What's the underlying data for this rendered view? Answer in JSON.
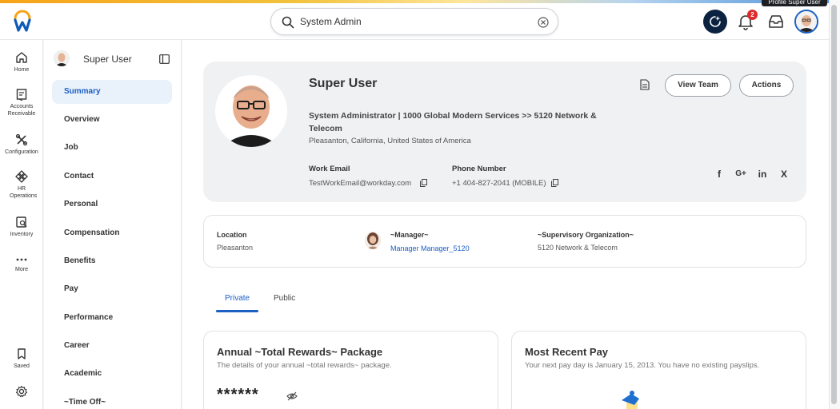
{
  "topbar": {
    "search_value": "System Admin",
    "notification_count": "2",
    "tooltip": "Profile Super User"
  },
  "rail": {
    "items": [
      {
        "label": "Home",
        "icon": "home-icon"
      },
      {
        "label": "Accounts Receivable",
        "icon": "invoice-icon"
      },
      {
        "label": "Configuration",
        "icon": "tools-icon"
      },
      {
        "label": "HR Operations",
        "icon": "hr-operations-icon"
      },
      {
        "label": "Inventory",
        "icon": "inventory-icon"
      },
      {
        "label": "More",
        "icon": "more-dots-icon"
      },
      {
        "label": "Saved",
        "icon": "bookmark-icon"
      }
    ]
  },
  "sidenav": {
    "user_name": "Super User",
    "items": [
      {
        "label": "Summary"
      },
      {
        "label": "Overview"
      },
      {
        "label": "Job"
      },
      {
        "label": "Contact"
      },
      {
        "label": "Personal"
      },
      {
        "label": "Compensation"
      },
      {
        "label": "Benefits"
      },
      {
        "label": "Pay"
      },
      {
        "label": "Performance"
      },
      {
        "label": "Career"
      },
      {
        "label": "Academic"
      },
      {
        "label": "~Time Off~"
      }
    ]
  },
  "profile": {
    "name": "Super User",
    "title": "System Administrator | 1000 Global Modern Services >> 5120 Network & Telecom",
    "location": "Pleasanton, California, United States of America",
    "work_email_label": "Work Email",
    "work_email": "TestWorkEmail@workday.com",
    "phone_label": "Phone Number",
    "phone": "+1 404-827-2041 (MOBILE)",
    "view_team_label": "View Team",
    "actions_label": "Actions",
    "social": [
      "f",
      "G+",
      "in",
      "X"
    ]
  },
  "info": {
    "location_label": "Location",
    "location_value": "Pleasanton",
    "manager_label": "~Manager~",
    "manager_value": "Manager Manager_5120",
    "org_label": "~Supervisory Organization~",
    "org_value": "5120 Network & Telecom"
  },
  "tabs": [
    {
      "label": "Private",
      "active": true
    },
    {
      "label": "Public",
      "active": false
    }
  ],
  "cards": {
    "rewards_title": "Annual ~Total Rewards~ Package",
    "rewards_sub": "The details of your annual ~total rewards~ package.",
    "rewards_masked": "******",
    "pay_title": "Most Recent Pay",
    "pay_sub": "Your next pay day is January 15, 2013. You have no existing payslips."
  },
  "colors": {
    "accent": "#1a5fc4",
    "assistant": "#0b2340",
    "badge": "#de2b2b"
  }
}
